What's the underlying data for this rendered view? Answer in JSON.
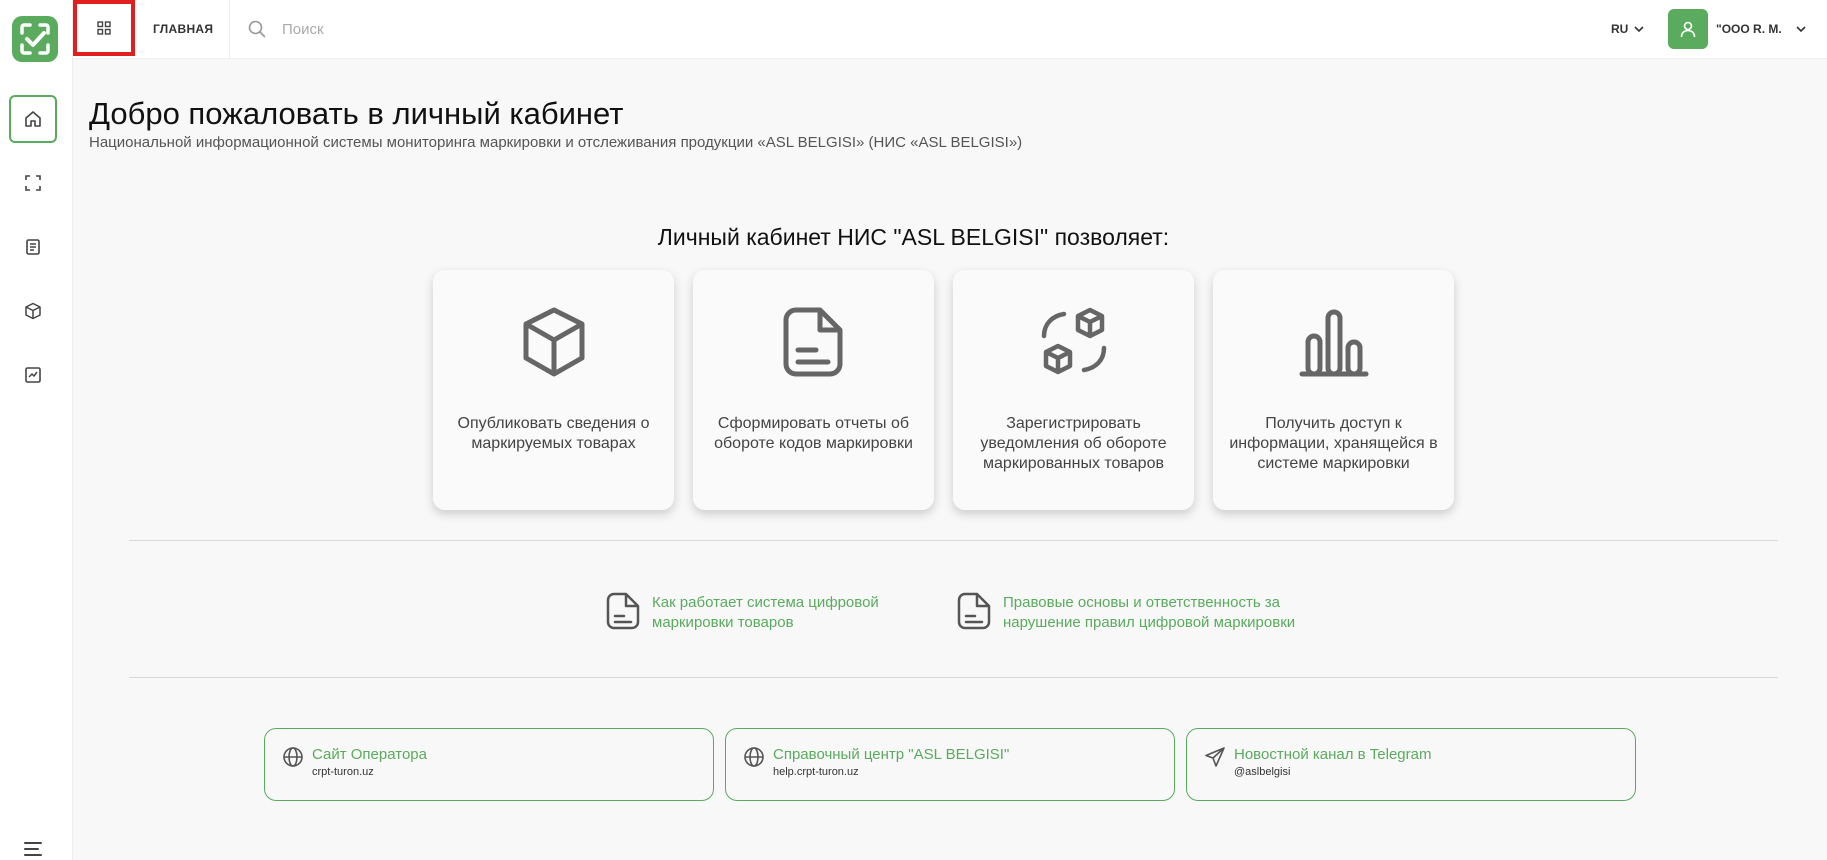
{
  "header": {
    "nav_main": "ГЛАВНАЯ",
    "search_placeholder": "Поиск",
    "lang": "RU",
    "user": "\"ООО R. M."
  },
  "main": {
    "title": "Добро пожаловать в личный кабинет",
    "subtitle": "Национальной информационной системы мониторинга маркировки и отслеживания продукции «ASL BELGISI» (НИС «ASL BELGISI»)",
    "section_title": "Личный кабинет НИС \"ASL BELGISI\" позволяет:",
    "cards": [
      {
        "icon": "box-icon",
        "text": "Опубликовать сведения о маркируемых товарах"
      },
      {
        "icon": "report-icon",
        "text": "Сформировать отчеты об обороте кодов маркировки"
      },
      {
        "icon": "exchange-icon",
        "text": "Зарегистрировать уведомления об обороте маркированных товаров"
      },
      {
        "icon": "bar-chart-icon",
        "text": "Получить доступ к информации, хранящейся в системе маркировки"
      }
    ],
    "doc_links": [
      {
        "text": "Как работает система цифровой маркировки товаров"
      },
      {
        "text": "Правовые основы и ответственность за нарушение правил цифровой маркировки"
      }
    ],
    "info_links": [
      {
        "icon": "globe-icon",
        "title": "Сайт Оператора",
        "sub": "crpt-turon.uz"
      },
      {
        "icon": "globe-icon",
        "title": "Справочный центр \"ASL BELGISI\"",
        "sub": "help.crpt-turon.uz"
      },
      {
        "icon": "telegram-icon",
        "title": "Новостной канал в Telegram",
        "sub": "@aslbelgisi"
      }
    ]
  },
  "colors": {
    "accent": "#5aab5e",
    "highlight": "#e02020"
  }
}
